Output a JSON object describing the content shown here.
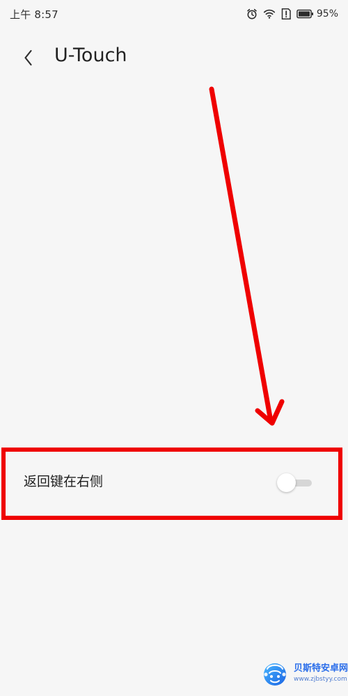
{
  "status_bar": {
    "time": "上午 8:57",
    "battery_percent": "95%",
    "icons": [
      "alarm-icon",
      "wifi-icon",
      "notification-icon",
      "battery-icon"
    ]
  },
  "header": {
    "back_icon": "chevron-left-icon",
    "title": "U-Touch"
  },
  "settings": {
    "row_label": "返回键在右侧",
    "toggle_state": "off"
  },
  "annotation": {
    "color": "#ef0000"
  },
  "watermark": {
    "name": "贝斯特安卓网",
    "url": "www.zjbstyy.com"
  },
  "colors": {
    "background": "#f6f6f6",
    "text": "#1f1f1f",
    "accent_red": "#ef0000",
    "toggle_track": "#d6d6d6"
  }
}
